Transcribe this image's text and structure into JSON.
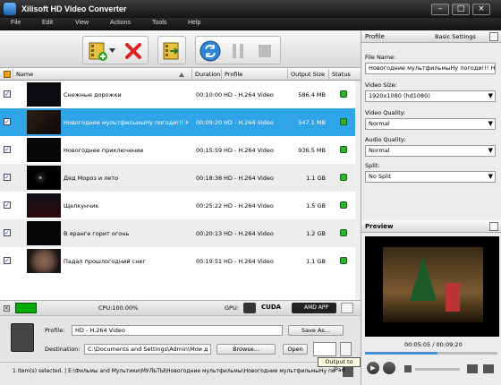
{
  "app": {
    "title": "Xilisoft HD Video Converter",
    "window_controls": [
      "–",
      "□",
      "×"
    ]
  },
  "menu": [
    "File",
    "Edit",
    "View",
    "Actions",
    "Tools",
    "Help"
  ],
  "list": {
    "headers": {
      "name": "Name",
      "duration": "Duration",
      "profile": "Profile",
      "output_size": "Output Size",
      "status": "Status"
    },
    "rows": [
      {
        "name": "Снежные дорожки",
        "duration": "00:10:00",
        "profile": "HD - H.264 Video",
        "size": "586.4 MB",
        "checked": true,
        "selected": false
      },
      {
        "name": "Новогоднее мультфильмыНу погоди!!! Н...",
        "duration": "00:09:20",
        "profile": "HD - H.264 Video",
        "size": "547.1 MB",
        "checked": true,
        "selected": true
      },
      {
        "name": "Новогоднее приключение",
        "duration": "00:15:59",
        "profile": "HD - H.264 Video",
        "size": "936.5 MB",
        "checked": true,
        "selected": false
      },
      {
        "name": "Дед Мороз и лето",
        "duration": "00:18:38",
        "profile": "HD - H.264 Video",
        "size": "1.1 GB",
        "checked": true,
        "selected": false
      },
      {
        "name": "Щелкунчик",
        "duration": "00:25:22",
        "profile": "HD - H.264 Video",
        "size": "1.5 GB",
        "checked": true,
        "selected": false
      },
      {
        "name": "В яранге горит огонь",
        "duration": "00:20:13",
        "profile": "HD - H.264 Video",
        "size": "1.2 GB",
        "checked": true,
        "selected": false
      },
      {
        "name": "Падал прошлогодний снег",
        "duration": "00:19:51",
        "profile": "HD - H.264 Video",
        "size": "1.1 GB",
        "checked": true,
        "selected": false
      }
    ]
  },
  "status": {
    "cpu": "CPU:100.00%",
    "gpu": "GPU:",
    "cuda": "CUDA",
    "amd": "AMD APP"
  },
  "bottom": {
    "profile_label": "Profile:",
    "profile_value": "HD - H.264 Video",
    "save_as": "Save As...",
    "destination_label": "Destination:",
    "destination_value": "C:\\Documents and Settings\\Admin\\Мои д",
    "browse": "Browse...",
    "open": "Open",
    "tooltip": "Output to iPad"
  },
  "footer": {
    "text": "1 item(s) selected. | E:\\Фильмы and Мультики\\МУЛЬТЫ\\Новогодние мультфильмы\\Новогодние мультфильмыНу погоди"
  },
  "right": {
    "profile_title": "Profile",
    "basic_settings": "Basic Settings",
    "file_name_label": "File Name:",
    "file_name_value": "Новогодние мультфильмыНу погоди!!! Нов",
    "video_size_label": "Video Size:",
    "video_size_value": "1920x1080 (hd1080)",
    "video_quality_label": "Video Quality:",
    "video_quality_value": "Normal",
    "audio_quality_label": "Audio Quality:",
    "audio_quality_value": "Normal",
    "split_label": "Split:",
    "split_value": "No Split",
    "preview_title": "Preview",
    "time": "00:05:05 / 00:09:20",
    "progress": 0.545
  }
}
